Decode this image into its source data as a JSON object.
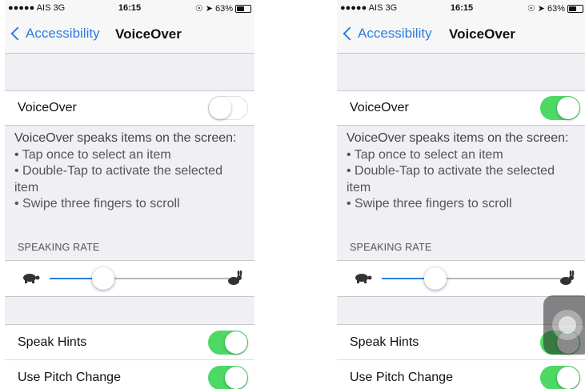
{
  "statusbar": {
    "carrier": "●●●●● AIS  3G",
    "time": "16:15",
    "battery": "63%",
    "battery_level": 0.63
  },
  "nav": {
    "back_label": "Accessibility",
    "title": "VoiceOver"
  },
  "voiceover": {
    "label": "VoiceOver"
  },
  "description": {
    "heading": "VoiceOver speaks items on the screen:",
    "bullets": [
      "Tap once to select an item",
      "Double-Tap to activate the selected item",
      "Swipe three fingers to scroll"
    ]
  },
  "speaking_rate": {
    "label": "SPEAKING RATE",
    "value": 0.3
  },
  "speak_hints": {
    "label": "Speak Hints",
    "state": "on"
  },
  "pitch_change": {
    "label": "Use Pitch Change",
    "state": "on"
  },
  "screens": [
    {
      "voiceover_state": "off",
      "show_assistive_touch": false
    },
    {
      "voiceover_state": "on",
      "show_assistive_touch": true
    }
  ],
  "colors": {
    "accent": "#2d7de0",
    "switch_on": "#4cd964",
    "background": "#efeff4"
  }
}
